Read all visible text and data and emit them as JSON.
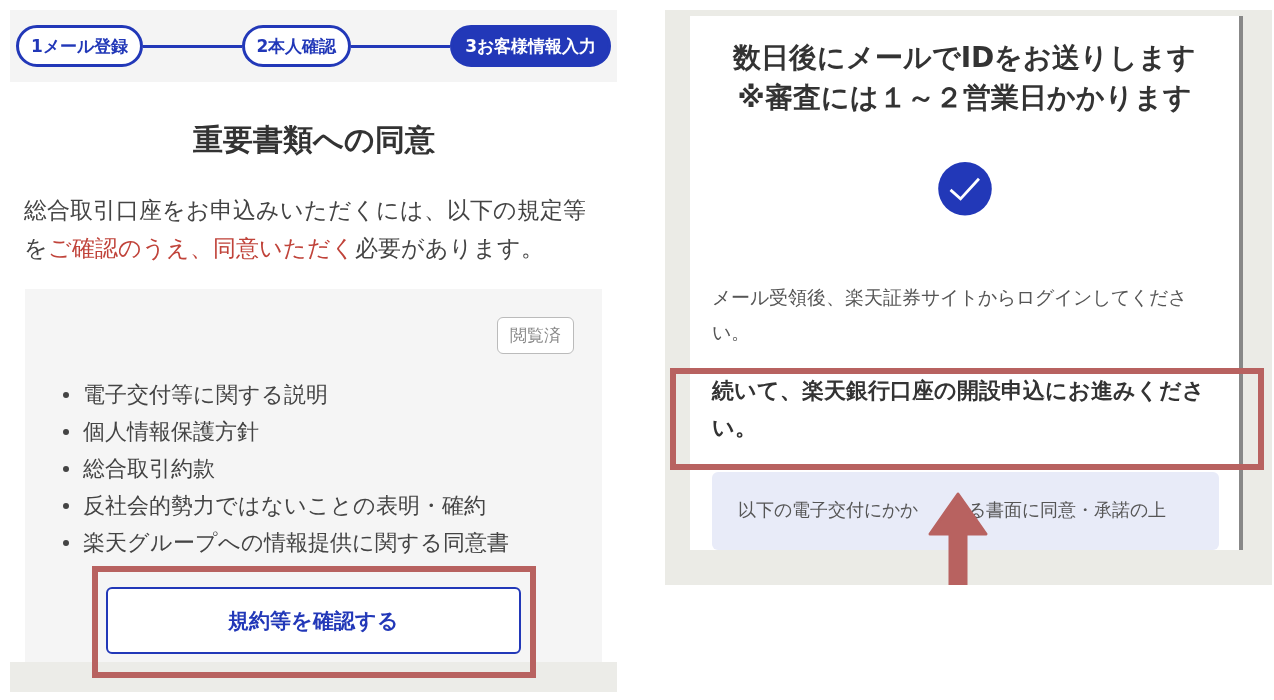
{
  "left_screen": {
    "steps": [
      {
        "label": "1メール登録",
        "selected": false
      },
      {
        "label": "2本人確認",
        "selected": false
      },
      {
        "label": "3お客様情報入力",
        "selected": true
      }
    ],
    "title": "重要書類への同意",
    "intro": [
      {
        "text": "総合取引口座をお申込みいただくには、以下の規定等を",
        "emphasis": false
      },
      {
        "text": "ご確認のうえ、同意いただく",
        "emphasis": true
      },
      {
        "text": "必要があります。",
        "emphasis": false
      }
    ],
    "documents": {
      "status_tag": "閲覧済",
      "items": [
        "電子交付等に関する説明",
        "個人情報保護方針",
        "総合取引約款",
        "反社会的勢力ではないことの表明・確約",
        "楽天グループへの情報提供に関する同意書"
      ],
      "button": "規約等を確認する",
      "button_highlighted": true
    }
  },
  "right_screen": {
    "heading": [
      "数日後にメールでIDをお送りします",
      "※審査には１～２営業日かかります"
    ],
    "message": "メール受領後、楽天証券サイトからログインしてください。",
    "next_step": "続いて、楽天銀行口座の開設申込にお進みください。",
    "next_step_highlighted": true,
    "next_step_arrow": true,
    "notice": [
      "以下の電子交付にかか",
      "る書面に同意・承諾の上"
    ]
  }
}
